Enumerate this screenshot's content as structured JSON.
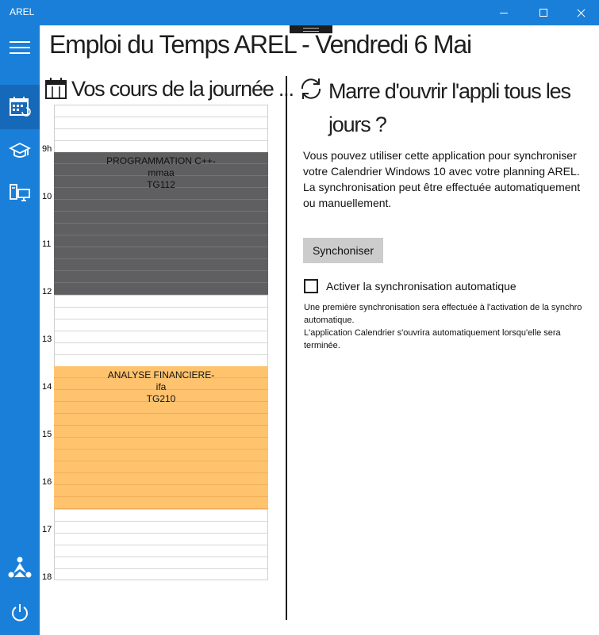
{
  "window": {
    "title": "AREL"
  },
  "page": {
    "title": "Emploi du Temps AREL - Vendredi 6 Mai"
  },
  "sidebar": {
    "items": [
      {
        "icon": "hamburger-menu-icon"
      },
      {
        "icon": "calendar-sync-icon",
        "active": true
      },
      {
        "icon": "graduation-cap-icon"
      },
      {
        "icon": "computer-network-icon"
      },
      {
        "icon": "arel-logo-icon"
      },
      {
        "icon": "power-icon"
      }
    ]
  },
  "schedule": {
    "title": "Vos cours de la journée ...",
    "hours": [
      "9h",
      "10",
      "11",
      "12",
      "13",
      "14",
      "15",
      "16",
      "17",
      "18"
    ],
    "courses": [
      {
        "name": "PROGRAMMATION C++-",
        "teacher": "mmaa",
        "room": "TG112",
        "start": "9h",
        "end": "12",
        "color": "#5f5f61"
      },
      {
        "name": "ANALYSE FINANCIERE-",
        "teacher": "ifa",
        "room": "TG210",
        "start": "14",
        "end": "17",
        "color": "#ffc36e"
      }
    ]
  },
  "sync": {
    "title": "Marre d'ouvrir l'appli tous les jours ?",
    "description": [
      "Vous pouvez utiliser cette application pour synchroniser votre Calendrier Windows 10 avec votre planning AREL.",
      "La synchronisation peut être effectuée automatiquement ou manuellement."
    ],
    "button_label": "Synchoniser",
    "auto_label": "Activer la synchronisation automatique",
    "auto_checked": false,
    "note": [
      "Une première synchronisation sera effectuée à l'activation de la synchro automatique.",
      "L'application Calendrier s'ouvrira automatiquement lorsqu'elle sera terminée."
    ]
  }
}
